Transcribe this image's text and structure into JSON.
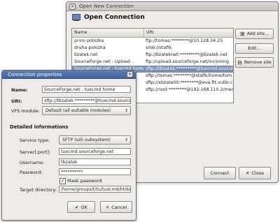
{
  "back_window": {
    "title": "Open New Connection",
    "header": "Open Connection",
    "columns": [
      "Name",
      "URI"
    ],
    "rows": [
      {
        "name": "prvni polozka",
        "uri": "ftp://tomas:********@10.128.34.25"
      },
      {
        "name": "druha polozka",
        "uri": "smb://stafik"
      },
      {
        "name": "bzatek.net",
        "uri": "ftp://bzateknet:*********@bzatek.net"
      },
      {
        "name": "SourceForge.net - Upload",
        "uri": "ftp://upload.sourceforge.net/incoming"
      },
      {
        "name": "SourceForge.net - tuxcmd home",
        "uri": "sftp://tbzatek:*********@tuxcmd.sourcef"
      },
      {
        "name": "",
        "uri": "sftp://tomas:********@stafik/home/tom"
      },
      {
        "name": "",
        "uri": "sftp://xbzate00:********@eva.fit.vutbr.cz"
      },
      {
        "name": "",
        "uri": "sftp://root:********@192.168.110.2/med"
      }
    ],
    "buttons": {
      "add": "Add site...",
      "edit": "Edit...",
      "remove": "Remove site",
      "connect": "Connect",
      "close": "Close"
    }
  },
  "dialog": {
    "title": "Connection properties",
    "name_label": "Name:",
    "name_value": "SourceForge.net - tuxcmd home",
    "uri_label": "URI:",
    "uri_value": "sftp://tbzatek:*********@tuxcmd.sourcef",
    "vfs_label": "VFS module:",
    "vfs_value": "Default (all suitable modules)",
    "section": "Detailed informations",
    "service_label": "Service type:",
    "service_value": "SFTP (ssh subsystem)",
    "server_label": "Server[:port]:",
    "server_value": "tuxcmd.sourceforge.net",
    "username_label": "Username:",
    "username_value": "tbzatek",
    "password_label": "Password:",
    "password_value": "**********",
    "mask_label": "Mask password",
    "mask_checked": true,
    "target_label": "Target directory:",
    "target_value": "/home/groups/t/tu/tuxcmd/htdocs",
    "ok": "OK",
    "cancel": "Cancel"
  },
  "colors": {
    "selection": "#7a8fb5",
    "title_active": "#4a6ca8"
  }
}
